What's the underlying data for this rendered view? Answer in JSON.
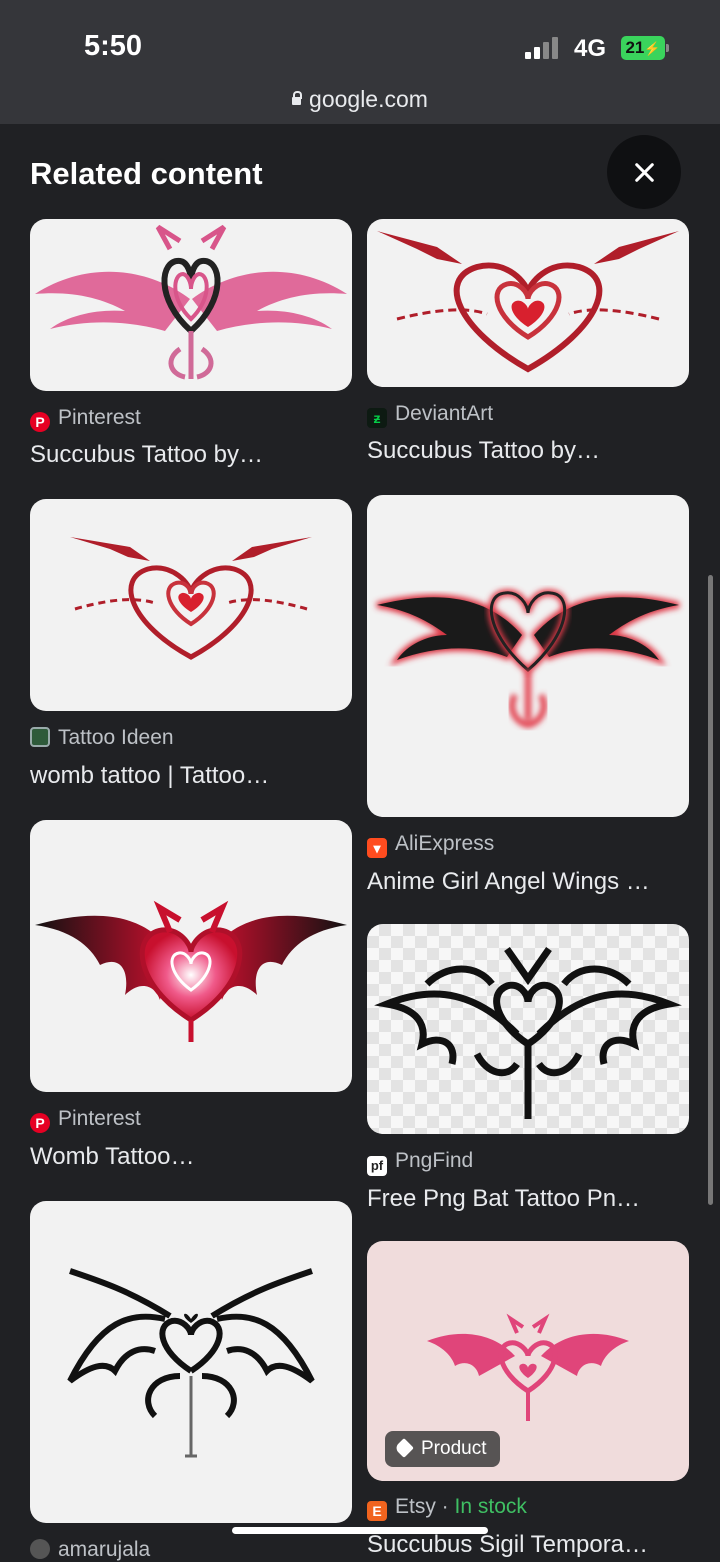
{
  "status": {
    "time": "5:50",
    "network": "4G",
    "battery": "21"
  },
  "browser": {
    "url": "google.com"
  },
  "panel": {
    "title": "Related content"
  },
  "results": [
    {
      "source": "Pinterest",
      "source_icon": "pinterest-icon",
      "title": "Succubus Tattoo by…"
    },
    {
      "source": "DeviantArt",
      "source_icon": "deviantart-icon",
      "title": "Succubus Tattoo by…"
    },
    {
      "source": "Tattoo Ideen",
      "source_icon": "tattoo-ideen-icon",
      "title": "womb tattoo | Tattoo…"
    },
    {
      "source": "AliExpress",
      "source_icon": "aliexpress-icon",
      "title": "Anime Girl Angel Wings …"
    },
    {
      "source": "Pinterest",
      "source_icon": "pinterest-icon",
      "title": "Womb Tattoo…"
    },
    {
      "source": "PngFind",
      "source_icon": "pngfind-icon",
      "title": "Free Png Bat Tattoo Pn…"
    },
    {
      "source": "amarujala",
      "source_icon": "amarujala-icon",
      "title": ""
    },
    {
      "source": "Etsy",
      "source_icon": "etsy-icon",
      "stock": "In stock",
      "badge": "Product",
      "title": "Succubus Sigil Tempora…"
    }
  ],
  "colors": {
    "background": "#202124",
    "topbar": "#35363a",
    "in_stock": "#3fbf63"
  }
}
